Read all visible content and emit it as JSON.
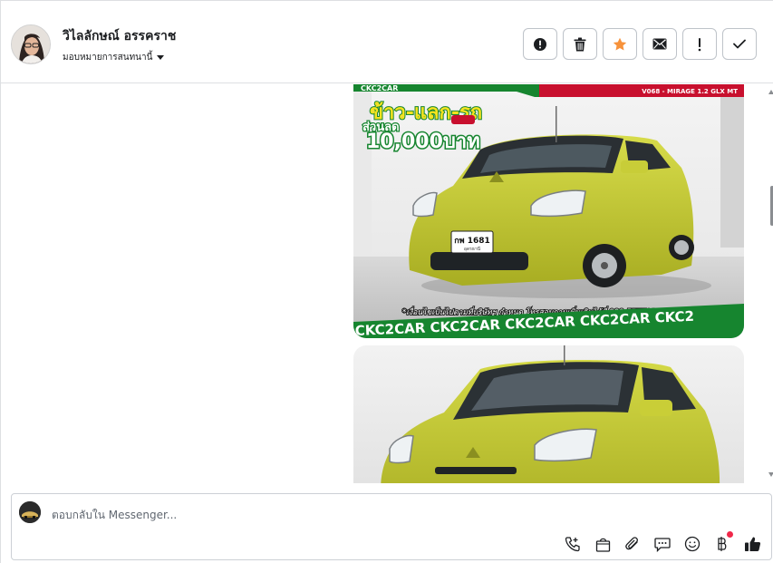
{
  "contact": {
    "name": "วิไลลักษณ์ อรรคราช",
    "assign_label": "มอบหมายการสนทนานี้"
  },
  "header_actions": [
    {
      "name": "spam-button",
      "icon": "alert-circle-icon"
    },
    {
      "name": "delete-button",
      "icon": "trash-icon"
    },
    {
      "name": "star-button",
      "icon": "star-icon",
      "color": "#f7923b"
    },
    {
      "name": "mark-unread-button",
      "icon": "envelope-icon"
    },
    {
      "name": "follow-up-button",
      "icon": "exclamation-icon"
    },
    {
      "name": "done-button",
      "icon": "check-icon"
    }
  ],
  "ad": {
    "badge": "V068 - MIRAGE 1.2 GLX MT",
    "headline": "ข้าว-แลก-รถ",
    "discount_label": "ส่วนลด",
    "discount_amount": "10,000บาท",
    "plate": "กพ 1681",
    "plate_province": "อุดรธานี",
    "footer_note": "*เงื่อนไขเป็นไปตามที่บริษัทฯ กำหนด โทรสอบถามเพิ่มเติมได้ที่ 088-5577932",
    "ticker": "CKC2CAR CKC2CAR CKC2CAR CKC2CAR CKC2",
    "top_strip": "CKC2CAR",
    "ticker_top": "CKC2CAR CKC2CAR CKC2CAR CKC2CAR CKC2"
  },
  "reply": {
    "placeholder": "ตอบกลับใน Messenger..."
  },
  "tools": [
    {
      "name": "call-icon"
    },
    {
      "name": "shopping-bag-icon"
    },
    {
      "name": "paperclip-icon"
    },
    {
      "name": "saved-reply-icon"
    },
    {
      "name": "emoji-icon"
    },
    {
      "name": "baht-payment-icon"
    },
    {
      "name": "like-icon"
    }
  ],
  "colors": {
    "accent": "#f7923b",
    "notification": "#f02849",
    "ad_green": "#16852f",
    "ad_red": "#c8102e",
    "car_yellow": "#c9cf35"
  }
}
